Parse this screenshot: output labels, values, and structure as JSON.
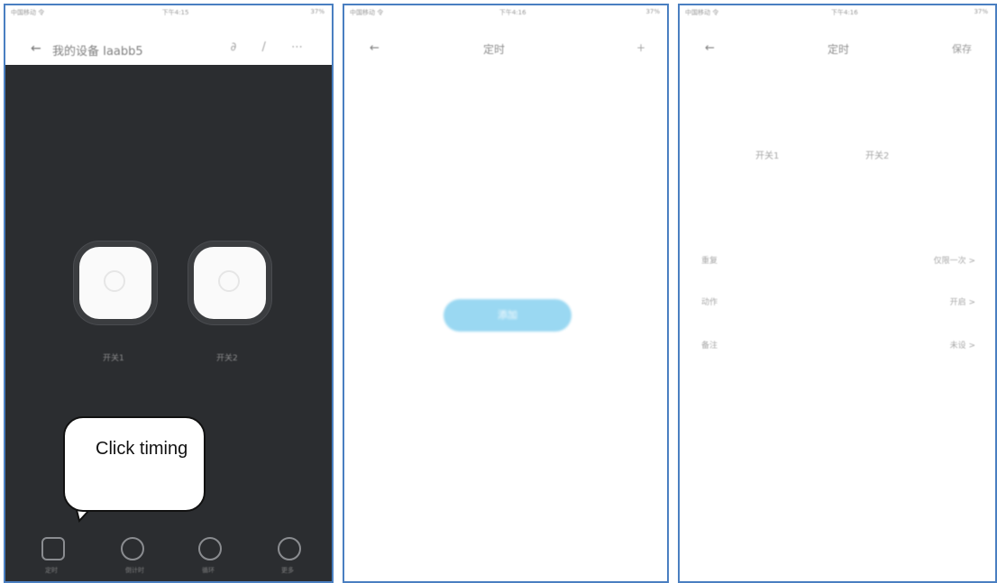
{
  "phone1": {
    "status": {
      "carrier": "中国移动 令",
      "time": "下午4:15",
      "battery": "37%"
    },
    "back_label": "←",
    "title": "我的设备 Iaabb5",
    "actions": "∂ / ⋯",
    "switch_labels": [
      "开关1",
      "开关2"
    ],
    "bottom_labels": [
      "定时",
      "倒计时",
      "循环",
      "更多"
    ],
    "callout": "Click timing"
  },
  "phone2": {
    "status": {
      "carrier": "中国移动 令",
      "time": "下午4:16",
      "battery": "37%"
    },
    "back_label": "←",
    "title": "定时",
    "plus_label": "+",
    "add_button": "添加"
  },
  "phone3": {
    "status": {
      "carrier": "中国移动 令",
      "time": "下午4:16",
      "battery": "37%"
    },
    "back_label": "←",
    "title": "定时",
    "save_label": "保存",
    "options": [
      "开关1",
      "开关2"
    ],
    "rows": [
      {
        "label": "重复",
        "value": "仅限一次 >"
      },
      {
        "label": "动作",
        "value": "开启 >"
      },
      {
        "label": "备注",
        "value": "未设 >"
      }
    ]
  }
}
